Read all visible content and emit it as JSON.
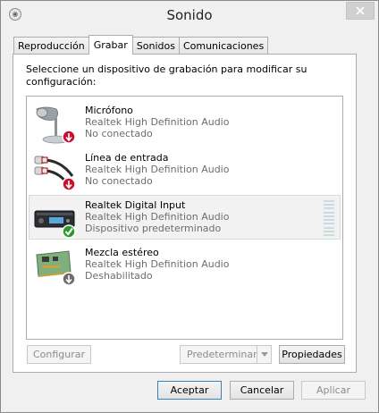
{
  "window": {
    "title": "Sonido"
  },
  "tabs": [
    {
      "label": "Reproducción"
    },
    {
      "label": "Grabar"
    },
    {
      "label": "Sonidos"
    },
    {
      "label": "Comunicaciones"
    }
  ],
  "instructions": "Seleccione un dispositivo de grabación para modificar su configuración:",
  "devices": [
    {
      "name": "Micrófono",
      "driver": "Realtek High Definition Audio",
      "status": "No conectado"
    },
    {
      "name": "Línea de entrada",
      "driver": "Realtek High Definition Audio",
      "status": "No conectado"
    },
    {
      "name": "Realtek Digital Input",
      "driver": "Realtek High Definition Audio",
      "status": "Dispositivo predeterminado"
    },
    {
      "name": "Mezcla estéreo",
      "driver": "Realtek High Definition Audio",
      "status": "Deshabilitado"
    }
  ],
  "panel_buttons": {
    "configure": "Configurar",
    "set_default": "Predeterminar",
    "properties": "Propiedades"
  },
  "dialog_buttons": {
    "ok": "Aceptar",
    "cancel": "Cancelar",
    "apply": "Aplicar"
  },
  "colors": {
    "accent": "#3c7fb1",
    "status_red": "#c8102e",
    "status_green": "#2e9a2e"
  }
}
